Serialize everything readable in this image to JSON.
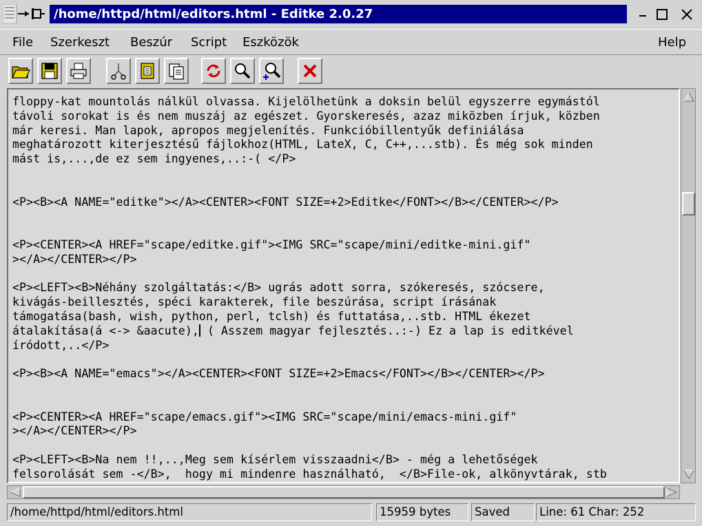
{
  "window": {
    "title": "/home/httpd/html/editors.html - Editke 2.0.27"
  },
  "menubar": {
    "file": "File",
    "edit": "Szerkeszt",
    "insert": "Beszúr",
    "script": "Script",
    "tools": "Eszközök",
    "help": "Help"
  },
  "toolbar": {
    "icons": [
      "open-folder-icon",
      "save-disk-icon",
      "print-icon",
      "cut-scissors-icon",
      "copy-icon",
      "paste-icon",
      "reload-icon",
      "find-icon",
      "find-next-icon",
      "close-x-icon"
    ]
  },
  "editor": {
    "lines": [
      "floppy-kat mountolás nálkül olvassa. Kijelölhetünk a doksin belül egyszerre egymástól",
      "távoli sorokat is és nem muszáj az egészet. Gyorskeresés, azaz miközben írjuk, közben",
      "már keresi. Man lapok, apropos megjelenítés. Funkcióbillentyűk definiálása",
      "meghatározott kiterjesztésű fájlokhoz(HTML, LateX, C, C++,...stb). És még sok minden",
      "mást is,...,de ez sem ingyenes,..:-( </P>",
      "",
      "",
      "<P><B><A NAME=\"editke\"></A><CENTER><FONT SIZE=+2>Editke</FONT></B></CENTER></P>",
      "",
      "",
      "<P><CENTER><A HREF=\"scape/editke.gif\"><IMG SRC=\"scape/mini/editke-mini.gif\"",
      "></A></CENTER></P>",
      "",
      "<P><LEFT><B>Néhány szolgáltatás:</B> ugrás adott sorra, szókeresés, szócsere,",
      "kivágás-beillesztés, spéci karakterek, file beszúrása, script írásának",
      "támogatása(bash, wish, python, perl, tclsh) és futtatása,..stb. HTML ékezet",
      "átalakítása(á <-> &aacute),",
      "íródott,..</P>",
      "",
      "<P><B><A NAME=\"emacs\"></A><CENTER><FONT SIZE=+2>Emacs</FONT></B></CENTER></P>",
      "",
      "",
      "<P><CENTER><A HREF=\"scape/emacs.gif\"><IMG SRC=\"scape/mini/emacs-mini.gif\"",
      "></A></CENTER></P>",
      "",
      "<P><LEFT><B>Na nem !!,..,Meg sem kísérlem visszaadni</B> - még a lehetőségek",
      "felsorolását sem -</B>,  hogy mi mindenre használható,  </B>File-ok, alkönyvtárak, stb"
    ],
    "cursor_line_rest": " ( Asszem magyar fejlesztés..:-) Ez a lap is editkével"
  },
  "statusbar": {
    "path": "/home/httpd/html/editors.html",
    "size": "15959 bytes",
    "state": "Saved",
    "position": "Line: 61   Char: 252"
  },
  "colors": {
    "title_bg": "#00008b",
    "title_fg": "#ffffff",
    "window_bg": "#d4d4d4",
    "editor_bg": "#d9d9d9",
    "close_x": "#cc0000",
    "reload": "#cc0000"
  }
}
